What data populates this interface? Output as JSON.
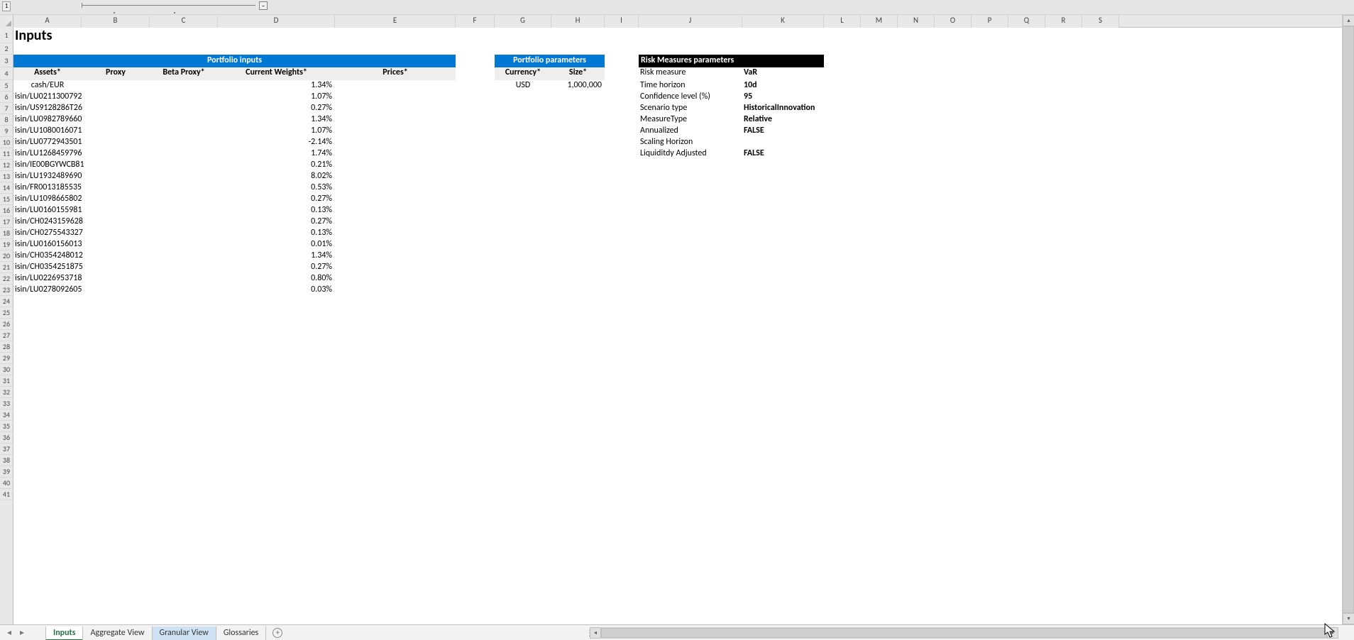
{
  "title": "Inputs",
  "columns": [
    "A",
    "B",
    "C",
    "D",
    "E",
    "F",
    "G",
    "H",
    "I",
    "J",
    "K",
    "L",
    "M",
    "N",
    "O",
    "P",
    "Q",
    "R",
    "S"
  ],
  "row_numbers": [
    1,
    2,
    3,
    4,
    5,
    6,
    7,
    8,
    9,
    10,
    11,
    12,
    13,
    14,
    15,
    16,
    17,
    18,
    19,
    20,
    21,
    22,
    23,
    24,
    25,
    26,
    27,
    28,
    29,
    30,
    31,
    32,
    33,
    34,
    35,
    36,
    37,
    38,
    39,
    40,
    41
  ],
  "portfolio_inputs": {
    "band_label": "Portfolio inputs",
    "headers": {
      "assets": "Assets*",
      "proxy": "Proxy",
      "beta_proxy": "Beta Proxy*",
      "weights": "Current Weights*",
      "prices": "Prices*"
    },
    "rows": [
      {
        "asset": "cash/EUR",
        "weight": "1.34%"
      },
      {
        "asset": "isin/LU0211300792",
        "weight": "1.07%"
      },
      {
        "asset": "isin/US9128286T26",
        "weight": "0.27%"
      },
      {
        "asset": "isin/LU0982789660",
        "weight": "1.34%"
      },
      {
        "asset": "isin/LU1080016071",
        "weight": "1.07%"
      },
      {
        "asset": "isin/LU0772943501",
        "weight": "-2.14%"
      },
      {
        "asset": "isin/LU1268459796",
        "weight": "1.74%"
      },
      {
        "asset": "isin/IE00BGYWCB81",
        "weight": "0.21%"
      },
      {
        "asset": "isin/LU1932489690",
        "weight": "8.02%"
      },
      {
        "asset": "isin/FR0013185535",
        "weight": "0.53%"
      },
      {
        "asset": "isin/LU1098665802",
        "weight": "0.27%"
      },
      {
        "asset": "isin/LU0160155981",
        "weight": "0.13%"
      },
      {
        "asset": "isin/CH0243159628",
        "weight": "0.27%"
      },
      {
        "asset": "isin/CH0275543327",
        "weight": "0.13%"
      },
      {
        "asset": "isin/LU0160156013",
        "weight": "0.01%"
      },
      {
        "asset": "isin/CH0354248012",
        "weight": "1.34%"
      },
      {
        "asset": "isin/CH0354251875",
        "weight": "0.27%"
      },
      {
        "asset": "isin/LU0226953718",
        "weight": "0.80%"
      },
      {
        "asset": "isin/LU0278092605",
        "weight": "0.03%"
      }
    ]
  },
  "portfolio_parameters": {
    "band_label": "Portfolio parameters",
    "headers": {
      "currency": "Currency*",
      "size": "Size*"
    },
    "currency": "USD",
    "size": "1,000,000"
  },
  "risk_measures": {
    "band_label": "Risk Measures parameters",
    "rows": [
      {
        "label": "Risk measure",
        "value": "VaR"
      },
      {
        "label": "Time horizon",
        "value": "10d"
      },
      {
        "label": "Confidence level (%)",
        "value": "95"
      },
      {
        "label": "Scenario type",
        "value": "HistoricalInnovation"
      },
      {
        "label": "MeasureType",
        "value": "Relative"
      },
      {
        "label": "Annualized",
        "value": "FALSE"
      },
      {
        "label": "Scaling Horizon",
        "value": ""
      },
      {
        "label": "Liquiditdy Adjusted",
        "value": "FALSE"
      }
    ]
  },
  "tabs": {
    "items": [
      "Inputs",
      "Aggregate View",
      "Granular View",
      "Glossaries"
    ],
    "active": "Inputs",
    "selected": "Granular View"
  },
  "outline_level": "1"
}
